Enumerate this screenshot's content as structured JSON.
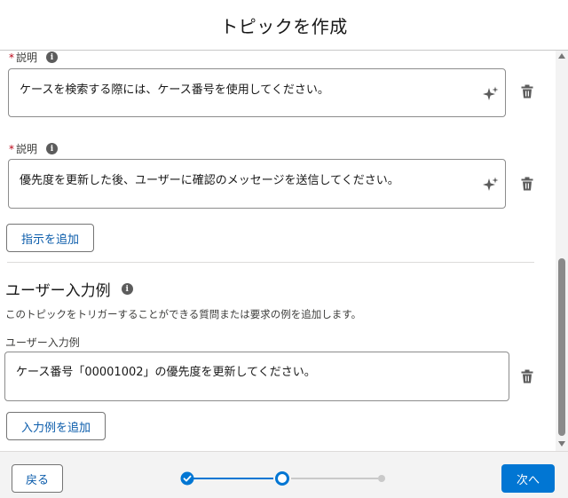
{
  "header": {
    "title": "トピックを作成"
  },
  "instructions": [
    {
      "label": "説明",
      "value": "ケースを検索する際には、ケース番号を使用してください。"
    },
    {
      "label": "説明",
      "value": "優先度を更新した後、ユーザーに確認のメッセージを送信してください。"
    }
  ],
  "add_instruction_label": "指示を追加",
  "examples_section": {
    "title": "ユーザー入力例",
    "description": "このトピックをトリガーすることができる質問または要求の例を追加します。",
    "field_label": "ユーザー入力例",
    "value": "ケース番号「00001002」の優先度を更新してください。",
    "add_label": "入力例を追加"
  },
  "footer": {
    "back_label": "戻る",
    "next_label": "次へ"
  },
  "progress": {
    "total_steps": 3,
    "current_step": 2
  },
  "colors": {
    "brand": "#0176d3",
    "link": "#0b5cab",
    "required": "#ba0517"
  },
  "icons": [
    "info-icon",
    "sparkle-icon",
    "trash-icon",
    "check-icon"
  ]
}
